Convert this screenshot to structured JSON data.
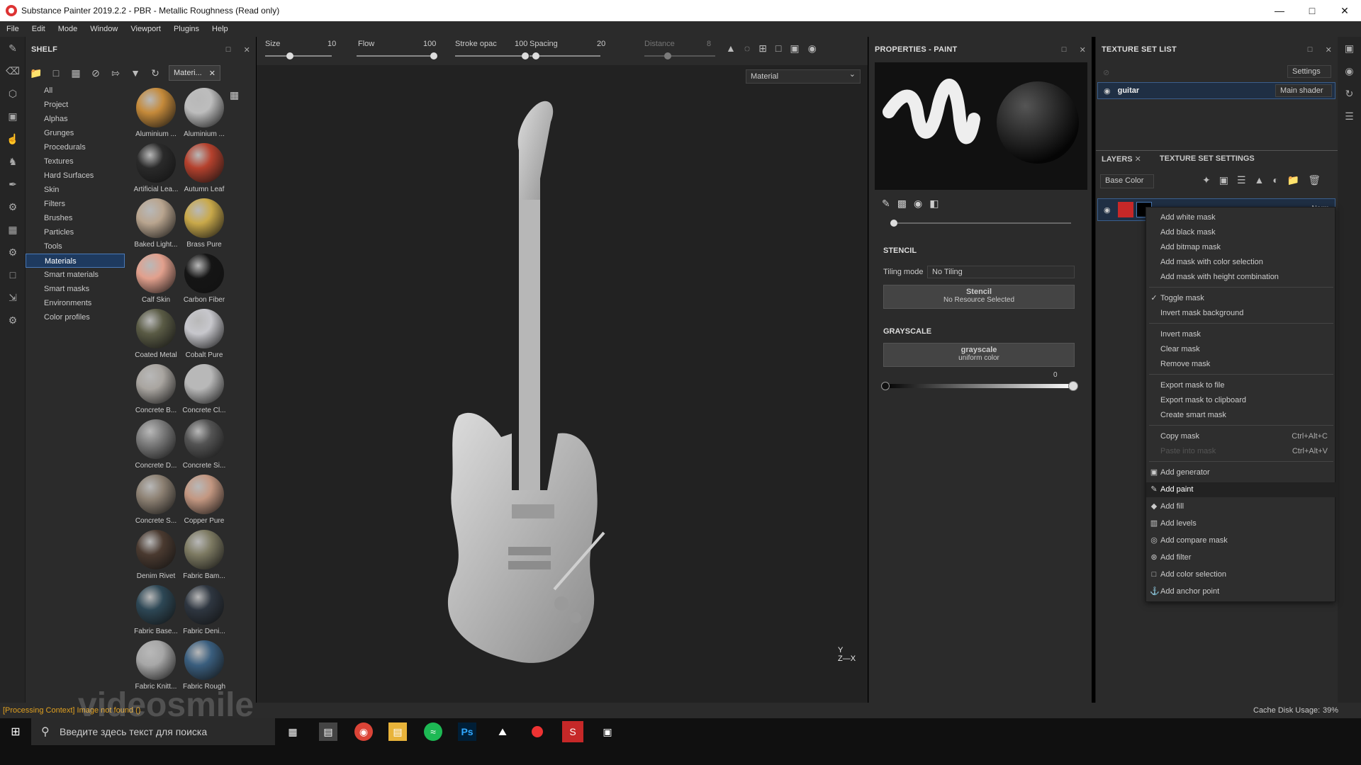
{
  "window": {
    "title": "Substance Painter 2019.2.2 - PBR - Metallic Roughness (Read only)"
  },
  "menu": [
    "File",
    "Edit",
    "Mode",
    "Window",
    "Viewport",
    "Plugins",
    "Help"
  ],
  "shelf": {
    "title": "SHELF",
    "filter": "Materi...",
    "categories": [
      "All",
      "Project",
      "Alphas",
      "Grunges",
      "Procedurals",
      "Textures",
      "Hard Surfaces",
      "Skin",
      "Filters",
      "Brushes",
      "Particles",
      "Tools",
      "Materials",
      "Smart materials",
      "Smart masks",
      "Environments",
      "Color profiles"
    ],
    "selected": "Materials",
    "materials": [
      {
        "name": "Aluminium ...",
        "color": "#c58a3a"
      },
      {
        "name": "Aluminium ...",
        "color": "#bdbdbd"
      },
      {
        "name": "Artificial Lea...",
        "color": "#2a2a2a"
      },
      {
        "name": "Autumn Leaf",
        "color": "#b5412d"
      },
      {
        "name": "Baked Light...",
        "color": "#b9a58f"
      },
      {
        "name": "Brass Pure",
        "color": "#c9a94a"
      },
      {
        "name": "Calf Skin",
        "color": "#e2a08d"
      },
      {
        "name": "Carbon Fiber",
        "color": "#151515"
      },
      {
        "name": "Coated Metal",
        "color": "#5a5b45"
      },
      {
        "name": "Cobalt Pure",
        "color": "#c7c7cc"
      },
      {
        "name": "Concrete B...",
        "color": "#a9a5a0"
      },
      {
        "name": "Concrete Cl...",
        "color": "#b8b8b8"
      },
      {
        "name": "Concrete D...",
        "color": "#7c7c7c"
      },
      {
        "name": "Concrete Si...",
        "color": "#545454"
      },
      {
        "name": "Concrete S...",
        "color": "#8d8173"
      },
      {
        "name": "Copper Pure",
        "color": "#c39781"
      },
      {
        "name": "Denim Rivet",
        "color": "#4a3a30"
      },
      {
        "name": "Fabric Bam...",
        "color": "#7d7a62"
      },
      {
        "name": "Fabric Base...",
        "color": "#2d4755"
      },
      {
        "name": "Fabric Deni...",
        "color": "#2e3640"
      },
      {
        "name": "Fabric Knitt...",
        "color": "#a7a7a7"
      },
      {
        "name": "Fabric Rough",
        "color": "#3a5e7e"
      }
    ]
  },
  "brush": {
    "size_label": "Size",
    "size_value": "10",
    "flow_label": "Flow",
    "flow_value": "100",
    "stroke_label": "Stroke opac",
    "stroke_value": "100",
    "spacing_label": "Spacing",
    "spacing_value": "20",
    "distance_label": "Distance",
    "distance_value": "8"
  },
  "viewport": {
    "mode": "Material",
    "axis_y": "Y",
    "axis_zx": "Z—X"
  },
  "properties": {
    "title": "PROPERTIES - PAINT",
    "stencil_title": "STENCIL",
    "tiling_label": "Tiling mode",
    "tiling_value": "No Tiling",
    "stencil_btn": "Stencil",
    "stencil_sub": "No Resource Selected",
    "grayscale_title": "GRAYSCALE",
    "grayscale_btn": "grayscale",
    "grayscale_sub": "uniform color",
    "grayscale_value": "0"
  },
  "textureset": {
    "title": "TEXTURE SET LIST",
    "settings": "Settings",
    "set_name": "guitar",
    "shader": "Main shader",
    "layers_tab": "LAYERS",
    "tss_tab": "TEXTURE SET SETTINGS",
    "channel": "Base Color",
    "blend": "Norm"
  },
  "context_menu": {
    "items": [
      {
        "label": "Add white mask"
      },
      {
        "label": "Add black mask"
      },
      {
        "label": "Add bitmap mask"
      },
      {
        "label": "Add mask with color selection"
      },
      {
        "label": "Add mask with height combination"
      },
      {
        "label": "Toggle mask",
        "check": "✓"
      },
      {
        "label": "Invert mask background"
      },
      {
        "label": "Invert mask"
      },
      {
        "label": "Clear mask"
      },
      {
        "label": "Remove mask"
      },
      {
        "label": "Export mask to file"
      },
      {
        "label": "Export mask to clipboard"
      },
      {
        "label": "Create smart mask"
      },
      {
        "label": "Copy mask",
        "shortcut": "Ctrl+Alt+C"
      },
      {
        "label": "Paste into mask",
        "shortcut": "Ctrl+Alt+V",
        "disabled": true
      },
      {
        "label": "Add generator",
        "icon": "generator-icon"
      },
      {
        "label": "Add paint",
        "icon": "paint-icon",
        "highlight": true
      },
      {
        "label": "Add fill",
        "icon": "fill-icon"
      },
      {
        "label": "Add levels",
        "icon": "levels-icon"
      },
      {
        "label": "Add compare mask",
        "icon": "compare-icon"
      },
      {
        "label": "Add filter",
        "icon": "filter-icon"
      },
      {
        "label": "Add color selection",
        "icon": "color-selection-icon"
      },
      {
        "label": "Add anchor point",
        "icon": "anchor-icon"
      }
    ]
  },
  "status": {
    "message": "[Processing Context] Image not found ()",
    "cache_label": "Cache Disk Usage:",
    "cache_value": "39%"
  },
  "taskbar": {
    "search_placeholder": "Введите здесь текст для поиска"
  },
  "watermark": "videosmile"
}
